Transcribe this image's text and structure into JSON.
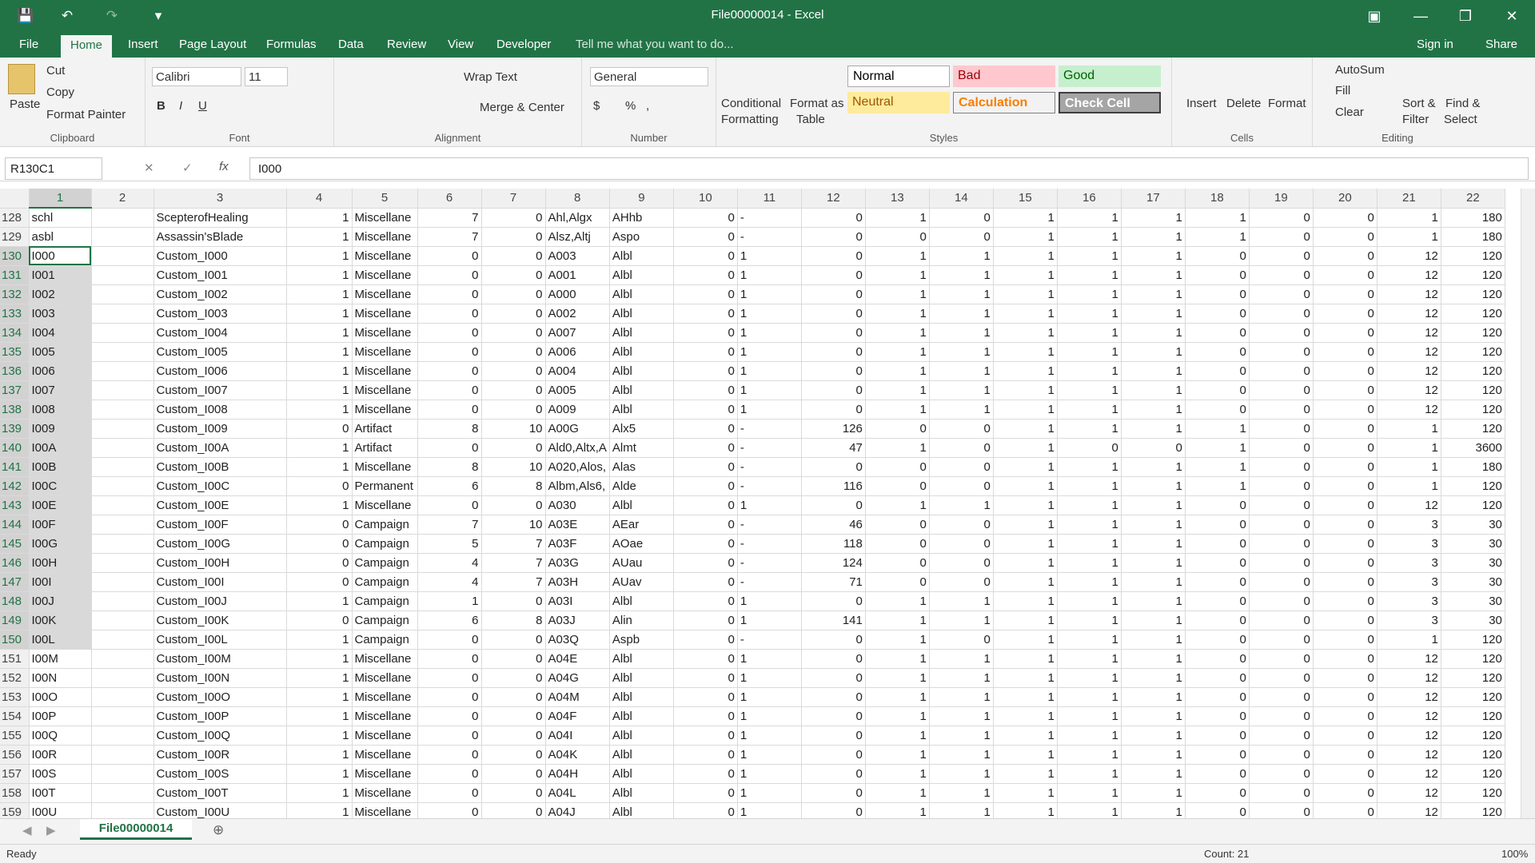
{
  "titlebar": {
    "title": "File00000014 - Excel",
    "save_icon": "save-icon",
    "undo_icon": "undo-icon",
    "redo_icon": "redo-icon",
    "customize_icon": "customize-icon"
  },
  "tabs": {
    "file": "File",
    "home": "Home",
    "insert": "Insert",
    "page_layout": "Page Layout",
    "formulas": "Formulas",
    "data": "Data",
    "review": "Review",
    "view": "View",
    "developer": "Developer",
    "tell_me": "Tell me what you want to do...",
    "sign_in": "Sign in",
    "share": "Share"
  },
  "ribbon": {
    "clipboard": {
      "label": "Clipboard",
      "paste": "Paste",
      "cut": "Cut",
      "copy": "Copy",
      "format_painter": "Format Painter"
    },
    "font": {
      "label": "Font",
      "name": "Calibri",
      "size": "11"
    },
    "alignment": {
      "label": "Alignment",
      "wrap_text": "Wrap Text",
      "merge_center": "Merge & Center"
    },
    "number": {
      "label": "Number",
      "format": "General",
      "currency": "$",
      "percent": "%",
      "comma": ","
    },
    "styles": {
      "label": "Styles",
      "conditional": "Conditional",
      "formatting": "Formatting",
      "format_as": "Format as",
      "table": "Table",
      "normal": "Normal",
      "bad": "Bad",
      "good": "Good",
      "neutral": "Neutral",
      "calculation": "Calculation",
      "check_cell": "Check Cell"
    },
    "cells": {
      "label": "Cells",
      "insert": "Insert",
      "delete": "Delete",
      "format": "Format"
    },
    "editing": {
      "label": "Editing",
      "autosum": "AutoSum",
      "fill": "Fill",
      "clear": "Clear",
      "sort_filter": "Sort &",
      "filter": "Filter",
      "find_select": "Find &",
      "select": "Select"
    }
  },
  "formula_bar": {
    "name_box": "R130C1",
    "fx": "fx",
    "value": "I000"
  },
  "columns": [
    "1",
    "2",
    "3",
    "4",
    "5",
    "6",
    "7",
    "8",
    "9",
    "10",
    "11",
    "12",
    "13",
    "14",
    "15",
    "16",
    "17",
    "18",
    "19",
    "20",
    "21",
    "22"
  ],
  "rows": [
    [
      "128",
      "schl",
      "",
      "ScepterofHealing",
      "1",
      "Miscellane",
      "7",
      "0",
      "Ahl,Algx",
      "AHhb",
      "0",
      "-",
      "0",
      "1",
      "0",
      "1",
      "1",
      "1",
      "1",
      "0",
      "0",
      "1",
      "180"
    ],
    [
      "129",
      "asbl",
      "",
      "Assassin'sBlade",
      "1",
      "Miscellane",
      "7",
      "0",
      "Alsz,Altj",
      "Aspo",
      "0",
      "-",
      "0",
      "0",
      "0",
      "1",
      "1",
      "1",
      "1",
      "0",
      "0",
      "1",
      "180"
    ],
    [
      "130",
      "I000",
      "",
      "Custom_I000",
      "1",
      "Miscellane",
      "0",
      "0",
      "A003",
      "Albl",
      "0",
      "1",
      "0",
      "1",
      "1",
      "1",
      "1",
      "1",
      "0",
      "0",
      "0",
      "12",
      "120"
    ],
    [
      "131",
      "I001",
      "",
      "Custom_I001",
      "1",
      "Miscellane",
      "0",
      "0",
      "A001",
      "Albl",
      "0",
      "1",
      "0",
      "1",
      "1",
      "1",
      "1",
      "1",
      "0",
      "0",
      "0",
      "12",
      "120"
    ],
    [
      "132",
      "I002",
      "",
      "Custom_I002",
      "1",
      "Miscellane",
      "0",
      "0",
      "A000",
      "Albl",
      "0",
      "1",
      "0",
      "1",
      "1",
      "1",
      "1",
      "1",
      "0",
      "0",
      "0",
      "12",
      "120"
    ],
    [
      "133",
      "I003",
      "",
      "Custom_I003",
      "1",
      "Miscellane",
      "0",
      "0",
      "A002",
      "Albl",
      "0",
      "1",
      "0",
      "1",
      "1",
      "1",
      "1",
      "1",
      "0",
      "0",
      "0",
      "12",
      "120"
    ],
    [
      "134",
      "I004",
      "",
      "Custom_I004",
      "1",
      "Miscellane",
      "0",
      "0",
      "A007",
      "Albl",
      "0",
      "1",
      "0",
      "1",
      "1",
      "1",
      "1",
      "1",
      "0",
      "0",
      "0",
      "12",
      "120"
    ],
    [
      "135",
      "I005",
      "",
      "Custom_I005",
      "1",
      "Miscellane",
      "0",
      "0",
      "A006",
      "Albl",
      "0",
      "1",
      "0",
      "1",
      "1",
      "1",
      "1",
      "1",
      "0",
      "0",
      "0",
      "12",
      "120"
    ],
    [
      "136",
      "I006",
      "",
      "Custom_I006",
      "1",
      "Miscellane",
      "0",
      "0",
      "A004",
      "Albl",
      "0",
      "1",
      "0",
      "1",
      "1",
      "1",
      "1",
      "1",
      "0",
      "0",
      "0",
      "12",
      "120"
    ],
    [
      "137",
      "I007",
      "",
      "Custom_I007",
      "1",
      "Miscellane",
      "0",
      "0",
      "A005",
      "Albl",
      "0",
      "1",
      "0",
      "1",
      "1",
      "1",
      "1",
      "1",
      "0",
      "0",
      "0",
      "12",
      "120"
    ],
    [
      "138",
      "I008",
      "",
      "Custom_I008",
      "1",
      "Miscellane",
      "0",
      "0",
      "A009",
      "Albl",
      "0",
      "1",
      "0",
      "1",
      "1",
      "1",
      "1",
      "1",
      "0",
      "0",
      "0",
      "12",
      "120"
    ],
    [
      "139",
      "I009",
      "",
      "Custom_I009",
      "0",
      "Artifact",
      "8",
      "10",
      "A00G",
      "Alx5",
      "0",
      "-",
      "126",
      "0",
      "0",
      "1",
      "1",
      "1",
      "1",
      "0",
      "0",
      "1",
      "120"
    ],
    [
      "140",
      "I00A",
      "",
      "Custom_I00A",
      "1",
      "Artifact",
      "0",
      "0",
      "Ald0,Altx,A",
      "Almt",
      "0",
      "-",
      "47",
      "1",
      "0",
      "1",
      "0",
      "0",
      "1",
      "0",
      "0",
      "1",
      "3600"
    ],
    [
      "141",
      "I00B",
      "",
      "Custom_I00B",
      "1",
      "Miscellane",
      "8",
      "10",
      "A020,Alos,",
      "Alas",
      "0",
      "-",
      "0",
      "0",
      "0",
      "1",
      "1",
      "1",
      "1",
      "0",
      "0",
      "1",
      "180"
    ],
    [
      "142",
      "I00C",
      "",
      "Custom_I00C",
      "0",
      "Permanent",
      "6",
      "8",
      "Albm,Als6,",
      "Alde",
      "0",
      "-",
      "116",
      "0",
      "0",
      "1",
      "1",
      "1",
      "1",
      "0",
      "0",
      "1",
      "120"
    ],
    [
      "143",
      "I00E",
      "",
      "Custom_I00E",
      "1",
      "Miscellane",
      "0",
      "0",
      "A030",
      "Albl",
      "0",
      "1",
      "0",
      "1",
      "1",
      "1",
      "1",
      "1",
      "0",
      "0",
      "0",
      "12",
      "120"
    ],
    [
      "144",
      "I00F",
      "",
      "Custom_I00F",
      "0",
      "Campaign",
      "7",
      "10",
      "A03E",
      "AEar",
      "0",
      "-",
      "46",
      "0",
      "0",
      "1",
      "1",
      "1",
      "0",
      "0",
      "0",
      "3",
      "30"
    ],
    [
      "145",
      "I00G",
      "",
      "Custom_I00G",
      "0",
      "Campaign",
      "5",
      "7",
      "A03F",
      "AOae",
      "0",
      "-",
      "118",
      "0",
      "0",
      "1",
      "1",
      "1",
      "0",
      "0",
      "0",
      "3",
      "30"
    ],
    [
      "146",
      "I00H",
      "",
      "Custom_I00H",
      "0",
      "Campaign",
      "4",
      "7",
      "A03G",
      "AUau",
      "0",
      "-",
      "124",
      "0",
      "0",
      "1",
      "1",
      "1",
      "0",
      "0",
      "0",
      "3",
      "30"
    ],
    [
      "147",
      "I00I",
      "",
      "Custom_I00I",
      "0",
      "Campaign",
      "4",
      "7",
      "A03H",
      "AUav",
      "0",
      "-",
      "71",
      "0",
      "0",
      "1",
      "1",
      "1",
      "0",
      "0",
      "0",
      "3",
      "30"
    ],
    [
      "148",
      "I00J",
      "",
      "Custom_I00J",
      "1",
      "Campaign",
      "1",
      "0",
      "A03I",
      "Albl",
      "0",
      "1",
      "0",
      "1",
      "1",
      "1",
      "1",
      "1",
      "0",
      "0",
      "0",
      "3",
      "30"
    ],
    [
      "149",
      "I00K",
      "",
      "Custom_I00K",
      "0",
      "Campaign",
      "6",
      "8",
      "A03J",
      "Alin",
      "0",
      "1",
      "141",
      "1",
      "1",
      "1",
      "1",
      "1",
      "0",
      "0",
      "0",
      "3",
      "30"
    ],
    [
      "150",
      "I00L",
      "",
      "Custom_I00L",
      "1",
      "Campaign",
      "0",
      "0",
      "A03Q",
      "Aspb",
      "0",
      "-",
      "0",
      "1",
      "0",
      "1",
      "1",
      "1",
      "0",
      "0",
      "0",
      "1",
      "120"
    ],
    [
      "151",
      "I00M",
      "",
      "Custom_I00M",
      "1",
      "Miscellane",
      "0",
      "0",
      "A04E",
      "Albl",
      "0",
      "1",
      "0",
      "1",
      "1",
      "1",
      "1",
      "1",
      "0",
      "0",
      "0",
      "12",
      "120"
    ],
    [
      "152",
      "I00N",
      "",
      "Custom_I00N",
      "1",
      "Miscellane",
      "0",
      "0",
      "A04G",
      "Albl",
      "0",
      "1",
      "0",
      "1",
      "1",
      "1",
      "1",
      "1",
      "0",
      "0",
      "0",
      "12",
      "120"
    ],
    [
      "153",
      "I00O",
      "",
      "Custom_I00O",
      "1",
      "Miscellane",
      "0",
      "0",
      "A04M",
      "Albl",
      "0",
      "1",
      "0",
      "1",
      "1",
      "1",
      "1",
      "1",
      "0",
      "0",
      "0",
      "12",
      "120"
    ],
    [
      "154",
      "I00P",
      "",
      "Custom_I00P",
      "1",
      "Miscellane",
      "0",
      "0",
      "A04F",
      "Albl",
      "0",
      "1",
      "0",
      "1",
      "1",
      "1",
      "1",
      "1",
      "0",
      "0",
      "0",
      "12",
      "120"
    ],
    [
      "155",
      "I00Q",
      "",
      "Custom_I00Q",
      "1",
      "Miscellane",
      "0",
      "0",
      "A04I",
      "Albl",
      "0",
      "1",
      "0",
      "1",
      "1",
      "1",
      "1",
      "1",
      "0",
      "0",
      "0",
      "12",
      "120"
    ],
    [
      "156",
      "I00R",
      "",
      "Custom_I00R",
      "1",
      "Miscellane",
      "0",
      "0",
      "A04K",
      "Albl",
      "0",
      "1",
      "0",
      "1",
      "1",
      "1",
      "1",
      "1",
      "0",
      "0",
      "0",
      "12",
      "120"
    ],
    [
      "157",
      "I00S",
      "",
      "Custom_I00S",
      "1",
      "Miscellane",
      "0",
      "0",
      "A04H",
      "Albl",
      "0",
      "1",
      "0",
      "1",
      "1",
      "1",
      "1",
      "1",
      "0",
      "0",
      "0",
      "12",
      "120"
    ],
    [
      "158",
      "I00T",
      "",
      "Custom_I00T",
      "1",
      "Miscellane",
      "0",
      "0",
      "A04L",
      "Albl",
      "0",
      "1",
      "0",
      "1",
      "1",
      "1",
      "1",
      "1",
      "0",
      "0",
      "0",
      "12",
      "120"
    ],
    [
      "159",
      "I00U",
      "",
      "Custom_I00U",
      "1",
      "Miscellane",
      "0",
      "0",
      "A04J",
      "Albl",
      "0",
      "1",
      "0",
      "1",
      "1",
      "1",
      "1",
      "1",
      "0",
      "0",
      "0",
      "12",
      "120"
    ]
  ],
  "sheet": {
    "tab": "File00000014"
  },
  "status": {
    "ready": "Ready",
    "count": "Count: 21",
    "zoom": "100%"
  }
}
